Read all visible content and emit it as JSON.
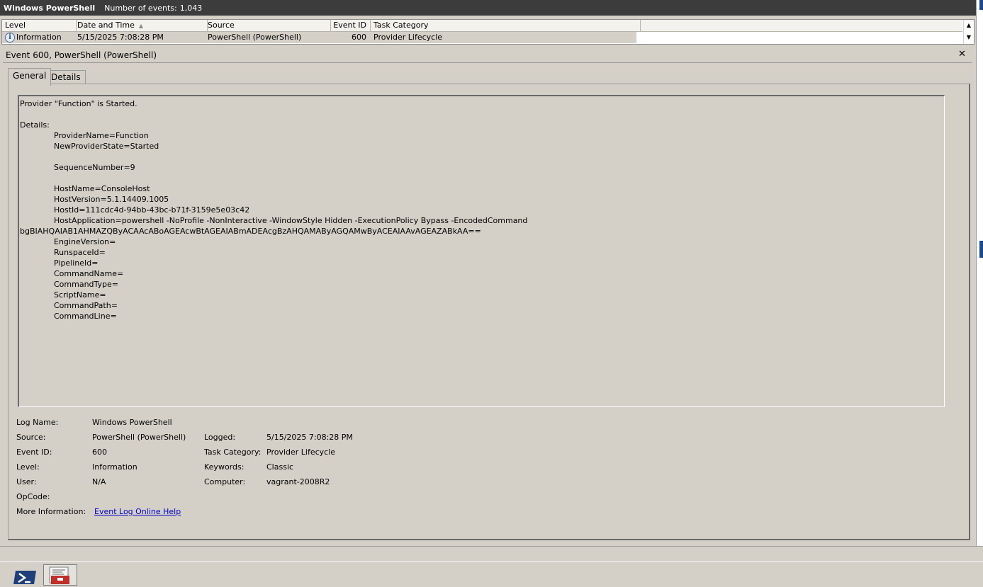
{
  "header": {
    "app_title": "Windows PowerShell",
    "count_label": "Number of events:",
    "count_value": "1,043"
  },
  "grid": {
    "columns": [
      "Level",
      "Date and Time",
      "Source",
      "Event ID",
      "Task Category"
    ],
    "rows": [
      {
        "level": "Information",
        "date": "5/15/2025 7:08:28 PM",
        "source": "PowerShell (PowerShell)",
        "event_id": "600",
        "task_category": "Provider Lifecycle"
      }
    ]
  },
  "details": {
    "title": "Event 600, PowerShell (PowerShell)",
    "tabs": [
      "General",
      "Details"
    ],
    "message": {
      "intro": "Provider \"Function\" is Started.",
      "details_label": "Details:",
      "provider_name": "ProviderName=Function",
      "new_provider_state": "NewProviderState=Started",
      "sequence_number": "SequenceNumber=9",
      "host_name": "HostName=ConsoleHost",
      "host_version": "HostVersion=5.1.14409.1005",
      "host_id": "HostId=111cdc4d-94bb-43bc-b71f-3159e5e03c42",
      "host_application": "HostApplication=powershell -NoProfile -NonInteractive -WindowStyle Hidden -ExecutionPolicy Bypass -EncodedCommand",
      "encoded_command": "bgBIAHQAIAB1AHMAZQByACAAcABoAGEAcwBtAGEAIABmADEAcgBzAHQAMAByAGQAMwByACEAIAAvAGEAZABkAA==",
      "engine_version": "EngineVersion=",
      "runspace_id": "RunspaceId=",
      "pipeline_id": "PipelineId=",
      "command_name": "CommandName=",
      "command_type": "CommandType=",
      "script_name": "ScriptName=",
      "command_path": "CommandPath=",
      "command_line": "CommandLine="
    },
    "properties": {
      "log_name_label": "Log Name:",
      "log_name": "Windows PowerShell",
      "source_label": "Source:",
      "source": "PowerShell (PowerShell)",
      "logged_label": "Logged:",
      "logged": "5/15/2025 7:08:28 PM",
      "event_id_label": "Event ID:",
      "event_id": "600",
      "task_category_label": "Task Category:",
      "task_category": "Provider Lifecycle",
      "level_label": "Level:",
      "level": "Information",
      "keywords_label": "Keywords:",
      "keywords": "Classic",
      "user_label": "User:",
      "user": "N/A",
      "computer_label": "Computer:",
      "computer": "vagrant-2008R2",
      "opcode_label": "OpCode:",
      "more_info_label": "More Information:",
      "more_info_link": "Event Log Online Help"
    }
  },
  "icons": {
    "close": "close-icon",
    "info": "info-icon",
    "sort": "sort-asc-icon",
    "taskbar_powershell": "powershell-icon",
    "taskbar_event_viewer": "event-viewer-icon"
  },
  "colors": {
    "title_bar": "#3c3c3c",
    "window_bg": "#d4d0c8",
    "link": "#0000cc",
    "powershell_blue": "#1f3f7a"
  }
}
